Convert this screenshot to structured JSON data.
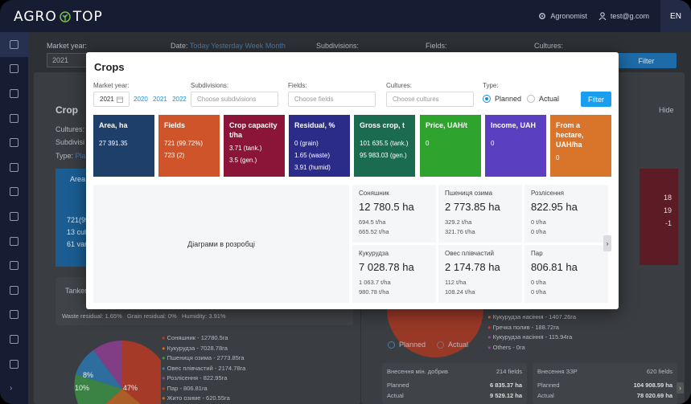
{
  "app": {
    "logo_left": "AGRO",
    "logo_right": "TOP",
    "role": "Agronomist",
    "user": "test@g.com",
    "lang": "EN"
  },
  "background": {
    "market_year_label": "Market year:",
    "market_year_value": "2021",
    "date_label": "Date:",
    "date_links": [
      "Today",
      "Yesterday",
      "Week",
      "Month"
    ],
    "subdivisions_label": "Subdivisions:",
    "fields_label": "Fields:",
    "cultures_label": "Cultures:",
    "filter_label": "Filter",
    "crops_title": "Crop",
    "hide_label": "Hide",
    "cultures_row": "Cultures:",
    "subdivisions_row": "Subdivisi",
    "type_row": "Type:",
    "type_link": "Pla",
    "area_label": "Area",
    "left_list": [
      "721(99",
      "13 cul",
      "61 var"
    ],
    "tanker_label": "Tanker",
    "residual_legend": [
      "Waste residual: 1.65%",
      "Grain residual: 0%",
      "Humidity: 3.91%"
    ],
    "pie_pct": [
      "47%",
      "10%",
      "8%"
    ],
    "crop_list": [
      "Соняшник - 12780.5га",
      "Кукурудза - 7028.78га",
      "Пшениця озима - 2773.85га",
      "Овес плівчастий - 2174.78га",
      "Розлісення - 822.95га",
      "Пар - 806.81га",
      "Жито озиме - 620.55га"
    ],
    "right_nums": [
      "18",
      "19",
      "-1"
    ],
    "right_list": [
      "Кукурудза насіння - 1407.26га",
      "Гречка полив - 188.72га",
      "Кукурудза насіння - 115.94га",
      "Others - 0га"
    ],
    "radio_planned": "Planned",
    "radio_actual": "Actual",
    "table1": {
      "title": "Внесення мін. добрив",
      "count": "214 fields",
      "rows": [
        [
          "Planned",
          "6 835.37 ha"
        ],
        [
          "Actual",
          "9 529.12 ha"
        ]
      ]
    },
    "table2": {
      "title": "Внесення ЗЗР",
      "count": "620 fields",
      "rows": [
        [
          "Planned",
          "104 908.59 ha"
        ],
        [
          "Actual",
          "78 020.69 ha"
        ]
      ]
    }
  },
  "modal": {
    "title": "Crops",
    "market_year_label": "Market year:",
    "market_year_value": "2021",
    "year_links": [
      "2020",
      "2021",
      "2022"
    ],
    "subdivisions_label": "Subdivisions:",
    "subdivisions_placeholder": "Choose subdivisions",
    "fields_label": "Fields:",
    "fields_placeholder": "Choose fields",
    "cultures_label": "Cultures:",
    "cultures_placeholder": "Choose cultures",
    "type_label": "Type:",
    "type_planned": "Planned",
    "type_actual": "Actual",
    "filter_label": "Filter",
    "stats": [
      {
        "title": "Area, ha",
        "lines": [
          "27 391.35"
        ],
        "color": "#1f3f6b"
      },
      {
        "title": "Fields",
        "lines": [
          "721 (99.72%)",
          "723 (2)"
        ],
        "color": "#d0542a"
      },
      {
        "title": "Crop capacity t/ha",
        "lines": [
          "3.71 (tank.)",
          "3.5 (gen.)"
        ],
        "color": "#8a1538"
      },
      {
        "title": "Residual, %",
        "lines": [
          "0 (grain)",
          "1.65 (waste)",
          "3.91 (humid)"
        ],
        "color": "#2b2b8a"
      },
      {
        "title": "Gross crop, t",
        "lines": [
          "101 635.5 (tank.)",
          "95 983.03 (gen.)"
        ],
        "color": "#1a6b50"
      },
      {
        "title": "Price, UAH/t",
        "lines": [
          "0"
        ],
        "color": "#2ea32e"
      },
      {
        "title": "Income, UAH",
        "lines": [
          "0"
        ],
        "color": "#5a3fc0"
      },
      {
        "title": "From a hectare, UAH/ha",
        "lines": [
          "0"
        ],
        "color": "#d9742b"
      }
    ],
    "chart_placeholder": "Діаграми в розробці",
    "crops": [
      {
        "name": "Соняшник",
        "area": "12 780.5 ha",
        "yield": "694.5 t/ha",
        "per": "665.52 t/ha"
      },
      {
        "name": "Пшениця озима",
        "area": "2 773.85 ha",
        "yield": "329.2 t/ha",
        "per": "321.76 t/ha"
      },
      {
        "name": "Розлісення",
        "area": "822.95 ha",
        "yield": "0 t/ha",
        "per": "0 t/ha"
      },
      {
        "name": "Кукурудза",
        "area": "7 028.78 ha",
        "yield": "1 063.7 t/ha",
        "per": "980.78 t/ha"
      },
      {
        "name": "Овес плівчастий",
        "area": "2 174.78 ha",
        "yield": "112 t/ha",
        "per": "108.24 t/ha"
      },
      {
        "name": "Пар",
        "area": "806.81 ha",
        "yield": "0 t/ha",
        "per": "0 t/ha"
      }
    ]
  }
}
